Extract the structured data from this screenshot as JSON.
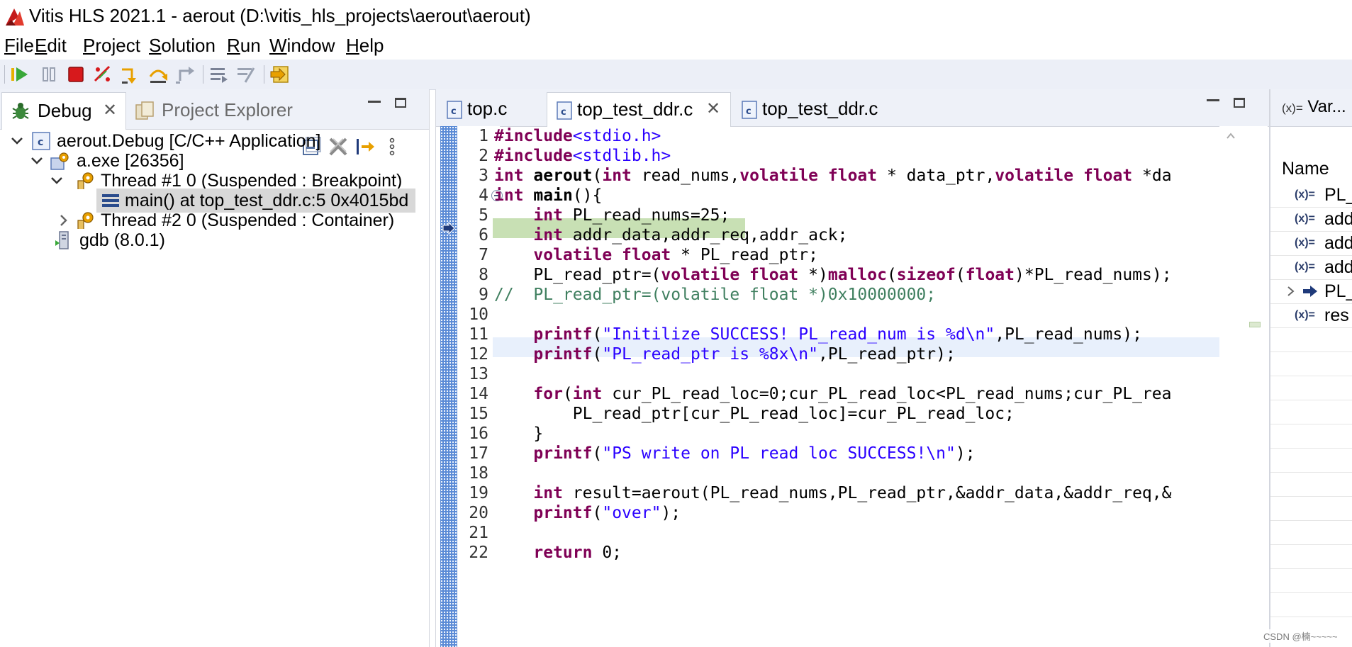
{
  "window": {
    "title": "Vitis HLS 2021.1 - aerout (D:\\vitis_hls_projects\\aerout\\aerout)"
  },
  "menu": [
    {
      "mnemonic": "F",
      "rest": "ile"
    },
    {
      "mnemonic": "E",
      "rest": "dit"
    },
    {
      "mnemonic": "P",
      "rest": "roject"
    },
    {
      "mnemonic": "S",
      "rest": "olution"
    },
    {
      "mnemonic": "R",
      "rest": "un"
    },
    {
      "mnemonic": "W",
      "rest": "indow"
    },
    {
      "mnemonic": "H",
      "rest": "elp"
    }
  ],
  "toolbar": {
    "buttons": [
      "resume-icon",
      "suspend-icon",
      "terminate-icon",
      "disconnect-icon",
      "step-into-icon",
      "step-over-icon",
      "step-return-icon",
      "instruction-stepping-icon",
      "use-step-filters-icon",
      "launch-icon"
    ]
  },
  "debug_panel": {
    "tabs": {
      "debug": "Debug",
      "project_explorer": "Project Explorer"
    },
    "tree": {
      "launch": "aerout.Debug [C/C++ Application]",
      "process": "a.exe [26356]",
      "thread1": "Thread #1 0 (Suspended : Breakpoint)",
      "frame": "main() at top_test_ddr.c:5 0x4015bd",
      "thread2": "Thread #2 0 (Suspended : Container)",
      "gdb": "gdb (8.0.1)"
    }
  },
  "editor": {
    "tabs": {
      "tab1": "top.c",
      "tab2": "top_test_ddr.c",
      "tab3": "top_test_ddr.c"
    },
    "active_tab": "top_test_ddr.c",
    "current_line": 5,
    "line_numbers": {
      "l1": "1",
      "l2": "2",
      "l3": "3",
      "l4": "4",
      "l5": "5",
      "l6": "6",
      "l7": "7",
      "l8": "8",
      "l9": "9",
      "l10": "10",
      "l11": "11",
      "l12": "12",
      "l13": "13",
      "l14": "14",
      "l15": "15",
      "l16": "16",
      "l17": "17",
      "l18": "18",
      "l19": "19",
      "l20": "20",
      "l21": "21",
      "l22": "22"
    },
    "code": {
      "l1_kw": "#include",
      "l1_str": "<stdio.h>",
      "l2_kw": "#include",
      "l2_str": "<stdlib.h>",
      "l3_kw1": "int",
      "l3_fn": "aerout",
      "l3_p1": "(",
      "l3_kw2": "int",
      "l3_p2": " read_nums,",
      "l3_kw3": "volatile",
      "l3_p3": " ",
      "l3_kw4": "float",
      "l3_p4": " * data_ptr,",
      "l3_kw5": "volatile",
      "l3_p5": " ",
      "l3_kw6": "float",
      "l3_p6": " *da",
      "l4_kw": "int",
      "l4_fn": "main",
      "l4_rest": "(){",
      "l5_indent": "    ",
      "l5_kw": "int",
      "l5_rest": " PL_read_nums=25;",
      "l6_indent": "    ",
      "l6_kw": "int",
      "l6_rest": " addr_data,addr_req,addr_ack;",
      "l7_indent": "    ",
      "l7_kw1": "volatile",
      "l7_sp": " ",
      "l7_kw2": "float",
      "l7_rest": " * PL_read_ptr;",
      "l8_p1": "    PL_read_ptr=(",
      "l8_kw1": "volatile",
      "l8_sp": " ",
      "l8_kw2": "float",
      "l8_p2": " *)",
      "l8_fn": "malloc",
      "l8_p3": "(",
      "l8_kw3": "sizeof",
      "l8_p4": "(",
      "l8_kw4": "float",
      "l8_p5": ")*PL_read_nums);",
      "l9_cmt": "//  PL_read_ptr=(volatile float *)0x10000000;",
      "l11_indent": "    ",
      "l11_fn": "printf",
      "l11_p1": "(",
      "l11_str": "\"Initilize SUCCESS! PL_read_num is %d\\n\"",
      "l11_p2": ",PL_read_nums);",
      "l12_indent": "    ",
      "l12_fn": "printf",
      "l12_p1": "(",
      "l12_str": "\"PL_read_ptr is %8x\\n\"",
      "l12_p2": ",PL_read_ptr);",
      "l14_indent": "    ",
      "l14_kw1": "for",
      "l14_p1": "(",
      "l14_kw2": "int",
      "l14_rest": " cur_PL_read_loc=0;cur_PL_read_loc<PL_read_nums;cur_PL_rea",
      "l15": "        PL_read_ptr[cur_PL_read_loc]=cur_PL_read_loc;",
      "l16": "    }",
      "l17_indent": "    ",
      "l17_fn": "printf",
      "l17_p1": "(",
      "l17_str": "\"PS write on PL read loc SUCCESS!\\n\"",
      "l17_p2": ");",
      "l19_indent": "    ",
      "l19_kw": "int",
      "l19_rest": " result=aerout(PL_read_nums,PL_read_ptr,&addr_data,&addr_req,&",
      "l20_indent": "    ",
      "l20_fn": "printf",
      "l20_p1": "(",
      "l20_str": "\"over\"",
      "l20_p2": ");",
      "l22_indent": "    ",
      "l22_kw": "return",
      "l22_rest": " 0;"
    }
  },
  "variables_panel": {
    "tab_icon": "(x)=",
    "tab_label": "Var...",
    "column_name": "Name",
    "var_icon": "(x)=",
    "rows": {
      "r1": "PL_",
      "r2": "add",
      "r3": "add",
      "r4": "add",
      "r5": "PL_",
      "r6": "res"
    }
  },
  "watermark": "CSDN @楠~~~~~"
}
